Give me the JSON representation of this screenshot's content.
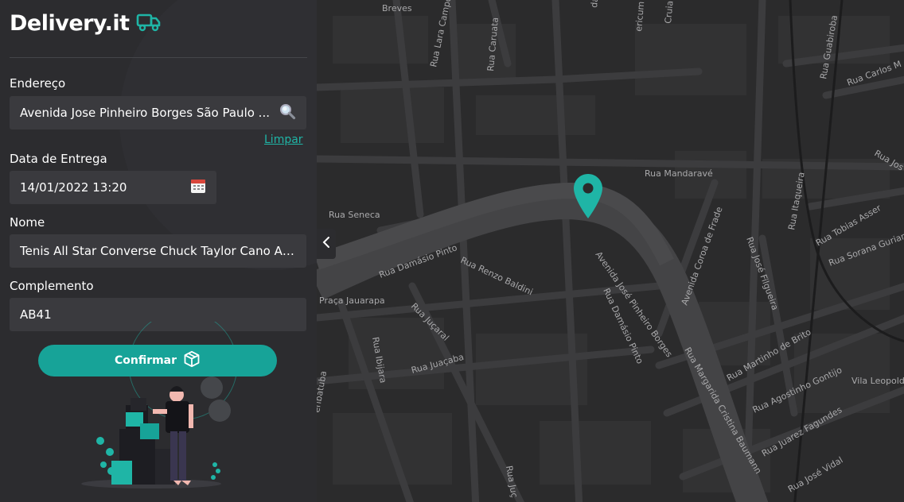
{
  "brand": {
    "name": "Delivery.it",
    "icon": "truck-icon",
    "accent": "#1fb5a6"
  },
  "form": {
    "address": {
      "label": "Endereço",
      "value": "Avenida Jose Pinheiro Borges São Paulo ...",
      "icon": "search-icon",
      "clear_label": "Limpar"
    },
    "date": {
      "label": "Data de Entrega",
      "value": "14/01/2022 13:20",
      "icon": "calendar-icon"
    },
    "name": {
      "label": "Nome",
      "value": "Tenis All Star Converse Chuck Taylor Cano Alto"
    },
    "complement": {
      "label": "Complemento",
      "value": "AB41"
    },
    "confirm_label": "Confirmar",
    "confirm_icon": "package-icon"
  },
  "map": {
    "toggle_icon": "chevron-left-icon",
    "marker_icon": "location-pin-icon",
    "marker_color": "#1fb5a6",
    "labels": [
      "Breves",
      "Rua Lara Campos",
      "Rua Caruata",
      "da Serra",
      "ericum",
      "Cruia",
      "Rua Guabiroba",
      "Rua Carlos M",
      "Rua Jos",
      "Rua Mandaravé",
      "Rua Seneca",
      "Rua Itaqueira",
      "Rua Tobias Asser",
      "Rua Sorana Guriani",
      "Rua Damásio Pinto",
      "Rua Renzo Baldini",
      "Avenida José Pinheiro Borges",
      "Rua Damásio Pinto",
      "Avenida Coroa de Frade",
      "Rua José Filgueira",
      "Praça Jauarapa",
      "Rua Juçaral",
      "Rua Ibijara",
      "Rua Juaçaba",
      "Rua Martinho de Brito",
      "Rua Agostinho Gontijo",
      "Vila Leopold",
      "Rua Juarez Fagundes",
      "Rua Margarida Cristina Baumann",
      "Rua José Vidal",
      "Rua Juç",
      "eribatuba"
    ]
  }
}
